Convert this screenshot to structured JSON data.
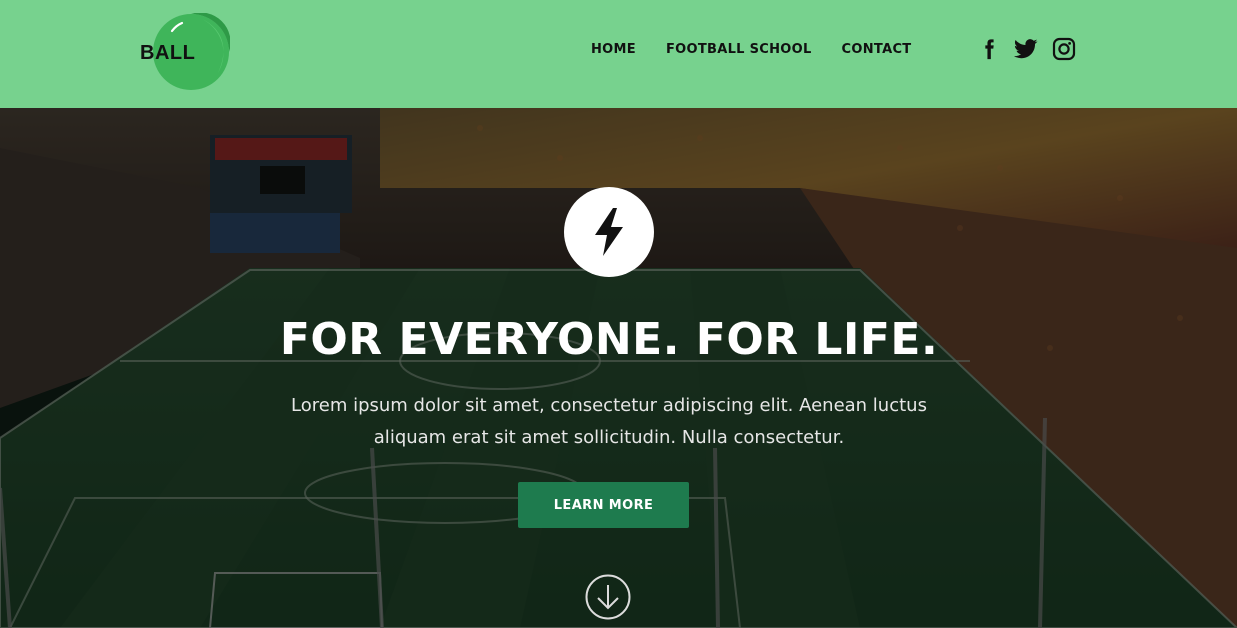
{
  "header": {
    "logo_text": "BALL",
    "nav": [
      {
        "label": "HOME"
      },
      {
        "label": "FOOTBALL SCHOOL"
      },
      {
        "label": "CONTACT"
      }
    ],
    "social": [
      "facebook-icon",
      "twitter-icon",
      "instagram-icon"
    ]
  },
  "hero": {
    "icon": "lightning-bolt-icon",
    "headline": "FOR EVERYONE. FOR LIFE.",
    "subtitle": "Lorem ipsum dolor sit amet, consectetur adipiscing elit. Aenean luctus aliquam erat sit amet sollicitudin. Nulla consectetur.",
    "cta_label": "LEARN MORE",
    "scroll_icon": "arrow-down-circle-icon"
  },
  "colors": {
    "header_bg": "#77d28e",
    "cta_bg": "#1e7b4e",
    "text_dark": "#111111"
  }
}
